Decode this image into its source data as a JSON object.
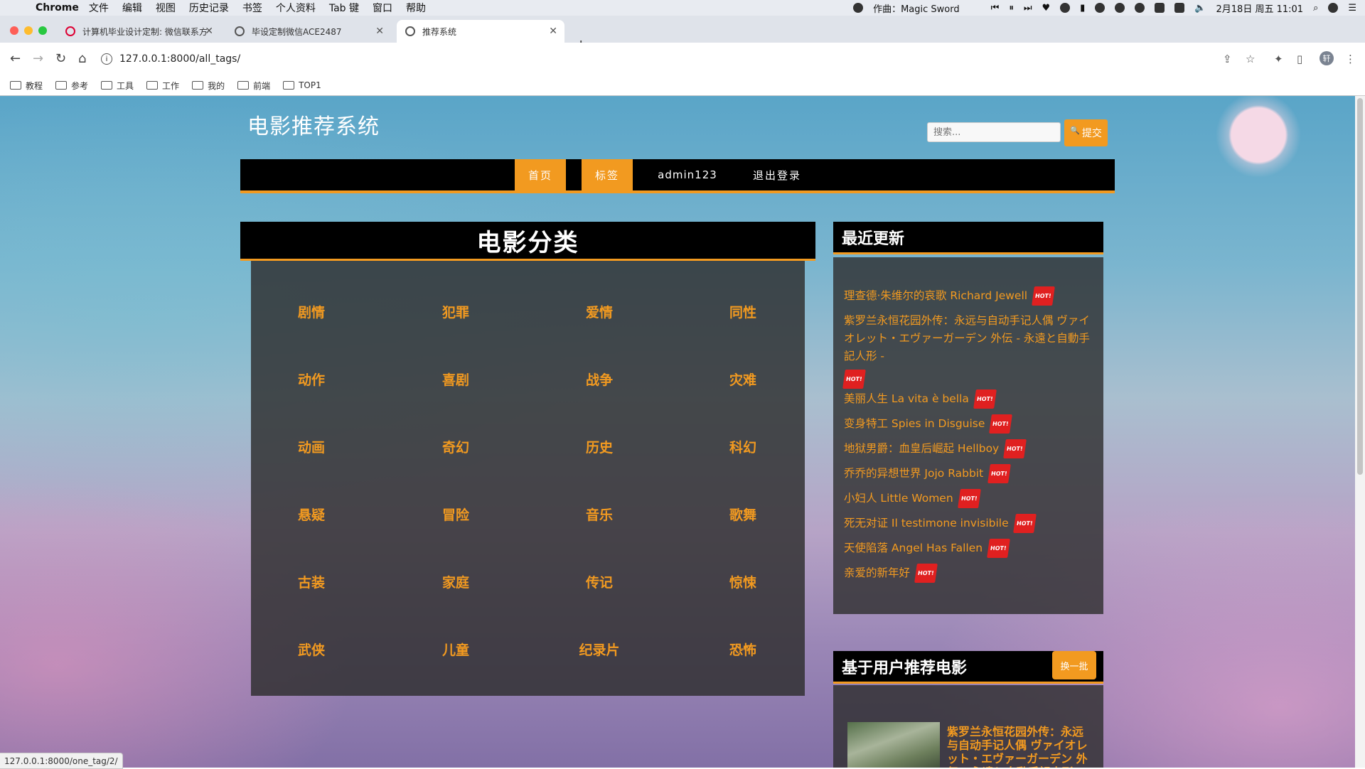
{
  "menubar": {
    "app": "Chrome",
    "items": [
      "文件",
      "编辑",
      "视图",
      "历史记录",
      "书签",
      "个人资料",
      "Tab 键",
      "窗口",
      "帮助"
    ],
    "now_playing": "作曲：Magic Sword",
    "clock": "2月18日 周五 11:01"
  },
  "tabs": [
    {
      "title": "计算机毕业设计定制: 微信联系方",
      "favicon": "red-logo-icon"
    },
    {
      "title": "毕设定制微信ACE2487",
      "favicon": "globe-icon"
    },
    {
      "title": "推荐系统",
      "favicon": "globe-icon",
      "active": true
    }
  ],
  "toolbar": {
    "url": "127.0.0.1:8000/all_tags/",
    "profile_initial": "轩"
  },
  "bookmarks": [
    "教程",
    "参考",
    "工具",
    "工作",
    "我的",
    "前端",
    "TOP1"
  ],
  "site": {
    "title": "电影推荐系统",
    "search_placeholder": "搜索...",
    "search_button": "提交"
  },
  "nav": [
    {
      "label": "首页",
      "active": true
    },
    {
      "label": "标签",
      "active": true
    },
    {
      "label": "admin123",
      "active": false
    },
    {
      "label": "退出登录",
      "active": false
    }
  ],
  "categories": {
    "heading": "电影分类",
    "items": [
      "剧情",
      "犯罪",
      "爱情",
      "同性",
      "动作",
      "喜剧",
      "战争",
      "灾难",
      "动画",
      "奇幻",
      "历史",
      "科幻",
      "悬疑",
      "冒险",
      "音乐",
      "歌舞",
      "古装",
      "家庭",
      "传记",
      "惊悚",
      "武侠",
      "儿童",
      "纪录片",
      "恐怖"
    ]
  },
  "recent": {
    "heading": "最近更新",
    "hot_label": "HOT!",
    "items": [
      "理查德·朱维尔的哀歌 Richard Jewell",
      "紫罗兰永恒花园外传：永远与自动手记人偶 ヴァイオレット・エヴァーガーデン 外伝 - 永遠と自動手記人形 -",
      "美丽人生 La vita è bella",
      "变身特工 Spies in Disguise",
      "地狱男爵：血皇后崛起 Hellboy",
      "乔乔的异想世界 Jojo Rabbit",
      "小妇人 Little Women",
      "死无对证 Il testimone invisibile",
      "天使陷落 Angel Has Fallen",
      "亲爱的新年好"
    ]
  },
  "recommend": {
    "heading": "基于用户推荐电影",
    "swap_button": "换一批",
    "first_title": "紫罗兰永恒花园外传：永远与自动手记人偶 ヴァイオレット・エヴァーガーデン 外伝 - 永遠と自動手記人形 -"
  },
  "status_url": "127.0.0.1:8000/one_tag/2/",
  "colors": {
    "accent": "#f29a20",
    "hot": "#e02020",
    "navbar": "#000000"
  }
}
